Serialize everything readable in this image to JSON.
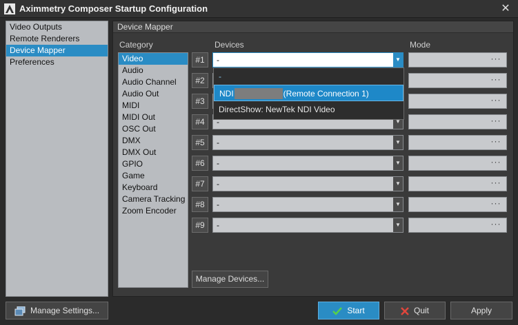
{
  "window": {
    "title": "Aximmetry Composer Startup Configuration",
    "close_label": "✕"
  },
  "sidebar": {
    "items": [
      {
        "label": "Video Outputs",
        "selected": false
      },
      {
        "label": "Remote Renderers",
        "selected": false
      },
      {
        "label": "Device Mapper",
        "selected": true
      },
      {
        "label": "Preferences",
        "selected": false
      }
    ]
  },
  "panel": {
    "header": "Device Mapper",
    "columns": {
      "category": "Category",
      "devices": "Devices",
      "mode": "Mode"
    },
    "categories": [
      "Video",
      "Audio",
      "Audio Channel",
      "Audio Out",
      "MIDI",
      "MIDI Out",
      "OSC Out",
      "DMX",
      "DMX Out",
      "GPIO",
      "Game",
      "Keyboard",
      "Camera Tracking",
      "Zoom Encoder"
    ],
    "selected_category": "Video",
    "slots": [
      {
        "label": "#1",
        "value": "-"
      },
      {
        "label": "#2",
        "value": "-"
      },
      {
        "label": "#3",
        "value": "-"
      },
      {
        "label": "#4",
        "value": "-"
      },
      {
        "label": "#5",
        "value": "-"
      },
      {
        "label": "#6",
        "value": "-"
      },
      {
        "label": "#7",
        "value": "-"
      },
      {
        "label": "#8",
        "value": "-"
      },
      {
        "label": "#9",
        "value": "-"
      }
    ],
    "mode_button_label": "···",
    "dropdown": {
      "options": [
        {
          "label": "-"
        },
        {
          "prefix": "NDI",
          "suffix": "(Remote Connection 1)",
          "highlighted": true
        },
        {
          "label": "DirectShow: NewTek NDI Video"
        }
      ]
    },
    "manage_devices_label": "Manage Devices..."
  },
  "footer": {
    "manage_settings_label": "Manage Settings...",
    "start_label": "Start",
    "quit_label": "Quit",
    "apply_label": "Apply"
  },
  "colors": {
    "accent": "#2a8cc4",
    "start_check": "#56d04a",
    "quit_x": "#e0463c"
  }
}
